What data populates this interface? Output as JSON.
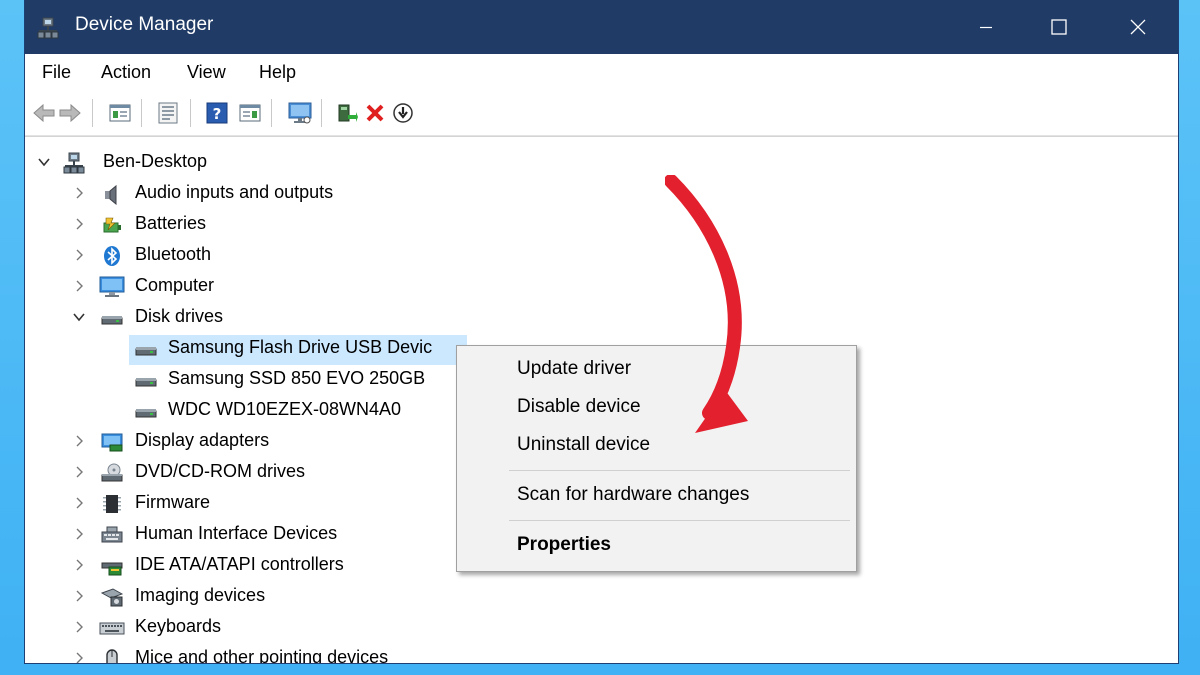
{
  "window": {
    "title": "Device Manager",
    "controls": {
      "minimize": "minimize",
      "maximize": "maximize",
      "close": "close"
    }
  },
  "menu": [
    "File",
    "Action",
    "View",
    "Help"
  ],
  "toolbar_icons": [
    "back-arrow-icon",
    "forward-arrow-icon",
    "show-hide-console-tree-icon",
    "properties-icon",
    "help-icon",
    "action-pane-icon",
    "monitor-icon",
    "update-driver-icon",
    "uninstall-x-icon",
    "disable-device-icon"
  ],
  "tree": {
    "root": "Ben-Desktop",
    "categories": [
      "Audio inputs and outputs",
      "Batteries",
      "Bluetooth",
      "Computer",
      "Disk drives",
      "Display adapters",
      "DVD/CD-ROM drives",
      "Firmware",
      "Human Interface Devices",
      "IDE ATA/ATAPI controllers",
      "Imaging devices",
      "Keyboards",
      "Mice and other pointing devices"
    ],
    "disk_drives": [
      "Samsung Flash Drive USB Devic",
      "Samsung SSD 850 EVO 250GB",
      "WDC WD10EZEX-08WN4A0"
    ]
  },
  "context_menu": {
    "items": [
      "Update driver",
      "Disable device",
      "Uninstall device",
      "Scan for hardware changes",
      "Properties"
    ]
  },
  "colors": {
    "background": "#45b6f6",
    "titlebar": "#1f3b66",
    "selection": "#cce8ff",
    "annotation_arrow": "#e3202d"
  }
}
